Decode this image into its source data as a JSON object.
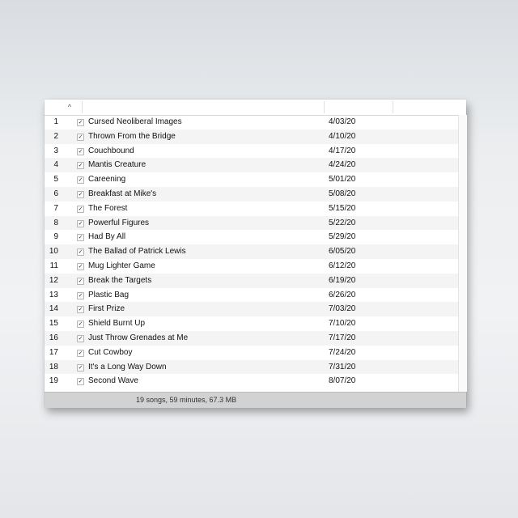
{
  "header": {
    "sort_icon": "sort-ascending-icon",
    "sort_glyph": "^"
  },
  "tracks": [
    {
      "num": "1",
      "name": "Cursed Neoliberal Images",
      "date": "4/03/20"
    },
    {
      "num": "2",
      "name": "Thrown From the Bridge",
      "date": "4/10/20"
    },
    {
      "num": "3",
      "name": "Couchbound",
      "date": "4/17/20"
    },
    {
      "num": "4",
      "name": "Mantis Creature",
      "date": "4/24/20"
    },
    {
      "num": "5",
      "name": "Careening",
      "date": "5/01/20"
    },
    {
      "num": "6",
      "name": "Breakfast at Mike's",
      "date": "5/08/20"
    },
    {
      "num": "7",
      "name": "The Forest",
      "date": "5/15/20"
    },
    {
      "num": "8",
      "name": "Powerful Figures",
      "date": "5/22/20"
    },
    {
      "num": "9",
      "name": "Had By All",
      "date": "5/29/20"
    },
    {
      "num": "10",
      "name": "The Ballad of Patrick Lewis",
      "date": "6/05/20"
    },
    {
      "num": "11",
      "name": "Mug Lighter Game",
      "date": "6/12/20"
    },
    {
      "num": "12",
      "name": "Break the Targets",
      "date": "6/19/20"
    },
    {
      "num": "13",
      "name": "Plastic Bag",
      "date": "6/26/20"
    },
    {
      "num": "14",
      "name": "First Prize",
      "date": "7/03/20"
    },
    {
      "num": "15",
      "name": "Shield Burnt Up",
      "date": "7/10/20"
    },
    {
      "num": "16",
      "name": "Just Throw Grenades at Me",
      "date": "7/17/20"
    },
    {
      "num": "17",
      "name": "Cut Cowboy",
      "date": "7/24/20"
    },
    {
      "num": "18",
      "name": "It's a Long Way Down",
      "date": "7/31/20"
    },
    {
      "num": "19",
      "name": "Second Wave",
      "date": "8/07/20"
    }
  ],
  "checkbox_icon": "checkmark-icon",
  "checkbox_glyph": "✓",
  "footer": {
    "summary": "19 songs, 59 minutes, 67.3 MB"
  }
}
